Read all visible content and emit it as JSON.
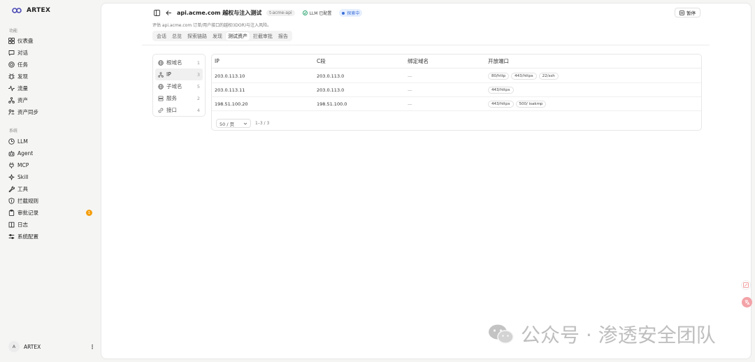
{
  "brand": {
    "name": "ARTEX"
  },
  "sidebar": {
    "section_function": "功能",
    "section_system": "系统",
    "function_items": [
      {
        "label": "仪表盘",
        "icon": "grid-icon"
      },
      {
        "label": "对话",
        "icon": "chat-icon"
      },
      {
        "label": "任务",
        "icon": "target-icon"
      },
      {
        "label": "发现",
        "icon": "bug-icon"
      },
      {
        "label": "流量",
        "icon": "activity-icon"
      },
      {
        "label": "资产",
        "icon": "network-icon"
      },
      {
        "label": "资产同步",
        "icon": "sync-icon"
      }
    ],
    "system_items": [
      {
        "label": "LLM",
        "icon": "llm-icon"
      },
      {
        "label": "Agent",
        "icon": "robot-icon"
      },
      {
        "label": "MCP",
        "icon": "plug-icon"
      },
      {
        "label": "Skill",
        "icon": "sparkle-icon"
      },
      {
        "label": "工具",
        "icon": "wrench-icon"
      },
      {
        "label": "拦截规则",
        "icon": "shield-icon"
      },
      {
        "label": "审批记录",
        "icon": "clipboard-icon",
        "badge": "1"
      },
      {
        "label": "日志",
        "icon": "book-icon"
      },
      {
        "label": "系统配置",
        "icon": "settings-icon"
      }
    ],
    "user": {
      "avatar": "A",
      "name": "ARTEX",
      "more": "⋮"
    }
  },
  "header": {
    "title": "api.acme.com 越权与注入测试",
    "tag": "t-acme-api",
    "llm_status": "LLM 已配置",
    "run_status": "探索中",
    "pause_label": "暂停",
    "subtitle": "评估 api.acme.com 订单/用户接口的越权(IDOR)与注入风险。"
  },
  "tabs": [
    {
      "label": "会话",
      "active": false
    },
    {
      "label": "总览",
      "active": false
    },
    {
      "label": "探索链路",
      "active": false
    },
    {
      "label": "发现",
      "active": false
    },
    {
      "label": "测试资产",
      "active": true
    },
    {
      "label": "拦截审批",
      "active": false
    },
    {
      "label": "报告",
      "active": false
    }
  ],
  "categories": [
    {
      "label": "根域名",
      "count": "1",
      "icon": "globe-icon",
      "active": false
    },
    {
      "label": "IP",
      "count": "3",
      "icon": "network-icon",
      "active": true
    },
    {
      "label": "子域名",
      "count": "5",
      "icon": "globe-icon",
      "active": false
    },
    {
      "label": "服务",
      "count": "2",
      "icon": "server-icon",
      "active": false
    },
    {
      "label": "接口",
      "count": "4",
      "icon": "link-icon",
      "active": false
    }
  ],
  "table": {
    "columns": [
      "IP",
      "C段",
      "绑定域名",
      "开放端口"
    ],
    "rows": [
      {
        "ip": "203.0.113.10",
        "c_segment": "203.0.113.0",
        "domain": "—",
        "ports": [
          "80/http",
          "443/https",
          "22/ssh"
        ]
      },
      {
        "ip": "203.0.113.11",
        "c_segment": "203.0.113.0",
        "domain": "—",
        "ports": [
          "443/https"
        ]
      },
      {
        "ip": "198.51.100.20",
        "c_segment": "198.51.100.0",
        "domain": "—",
        "ports": [
          "443/https",
          "500/ isakmp"
        ]
      }
    ],
    "page_size": "50 / 页",
    "range": "1–3 / 3"
  },
  "watermark": {
    "text": "公众号 · 渗透安全团队"
  },
  "colors": {
    "accent": "#3b6fd8",
    "badge": "#f59e0b",
    "llm_ok": "#22a06b"
  }
}
